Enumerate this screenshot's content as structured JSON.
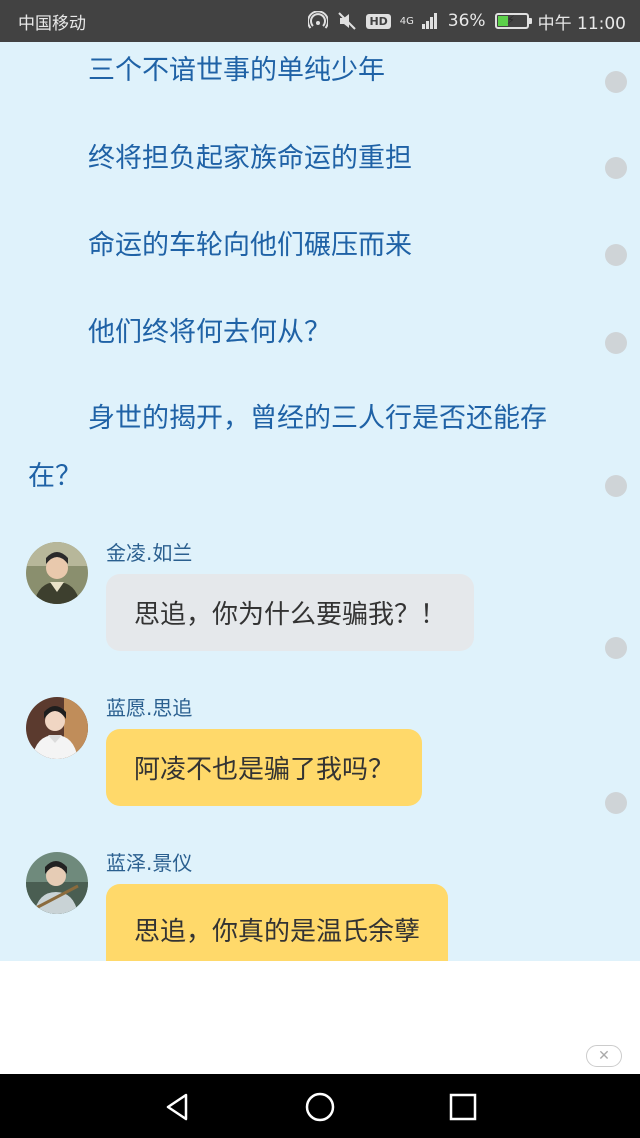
{
  "status_bar": {
    "carrier": "中国移动",
    "network_type": "4G",
    "hd": "HD",
    "battery": "36%",
    "battery_level": 0.36,
    "time": "中午 11:00"
  },
  "story": {
    "lines": [
      "三个不谙世事的单纯少年",
      "终将担负起家族命运的重担",
      "命运的车轮向他们碾压而来",
      "他们终将何去何从？",
      "身世的揭开，曾经的三人行是否还能存在？"
    ]
  },
  "messages": [
    {
      "sender": "金凌.如兰",
      "text": "思追，你为什么要骗我？！",
      "style": "gray"
    },
    {
      "sender": "蓝愿.思追",
      "text": "阿凌不也是骗了我吗？",
      "style": "yellow"
    },
    {
      "sender": "蓝泽.景仪",
      "text": "思追，你真的是温氏余孽",
      "style": "yellow"
    }
  ],
  "colors": {
    "background": "#dff2fb",
    "story_text": "#1f62a6",
    "bubble_gray": "#e5e8eb",
    "bubble_yellow": "#ffd96a",
    "status_bar": "#424242",
    "nav_bar": "#000000"
  },
  "icons": {
    "status": [
      "hotspot-icon",
      "mute-icon",
      "signal-icon",
      "battery-icon"
    ],
    "nav": [
      "back-icon",
      "home-icon",
      "recents-icon"
    ],
    "ad": "ad-close-icon"
  }
}
